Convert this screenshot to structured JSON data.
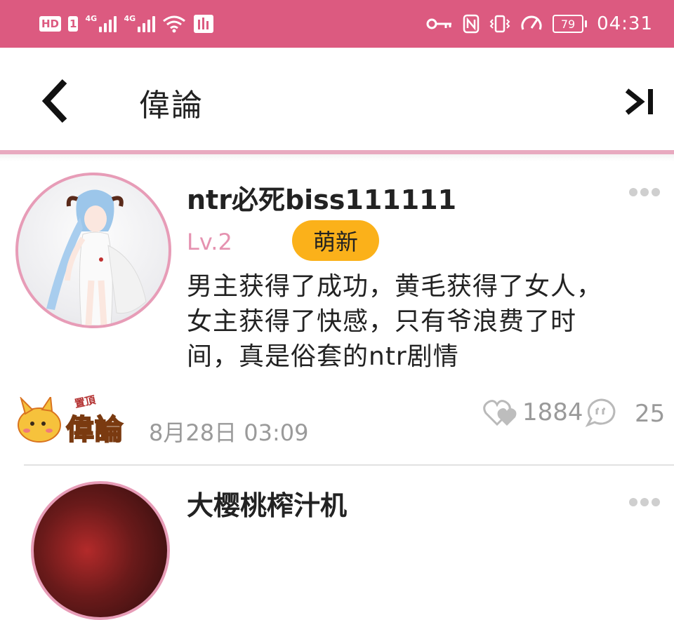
{
  "status_bar": {
    "hd": "HD",
    "sim": "1",
    "net1": "4G",
    "net2": "4G",
    "battery": "79",
    "time": "04:31"
  },
  "header": {
    "title": "偉論"
  },
  "comments": [
    {
      "username": "ntr必死biss111111",
      "level": "Lv.2",
      "badge": "萌新",
      "text_lines": [
        "男主获得了成功，黄毛获得了女人，",
        "女主获得了快感，只有爷浪费了时",
        "间，真是俗套的ntr剧情"
      ],
      "pinned_tag_small": "置頂",
      "pinned_tag_large": "偉論",
      "date": "8月28日 03:09",
      "likes": "1884",
      "replies": "25"
    },
    {
      "username": "大樱桃榨汁机"
    }
  ],
  "colors": {
    "status_bar": "#dc5a80",
    "accent_pink": "#e592b0",
    "badge": "#fbb11a"
  },
  "icons": [
    "back-arrow-icon",
    "skip-to-end-icon",
    "more-dots-icon",
    "heart-icon",
    "reply-bubble-icon",
    "wifi-icon",
    "key-icon",
    "nfc-icon",
    "vibrate-icon",
    "speed-icon"
  ]
}
